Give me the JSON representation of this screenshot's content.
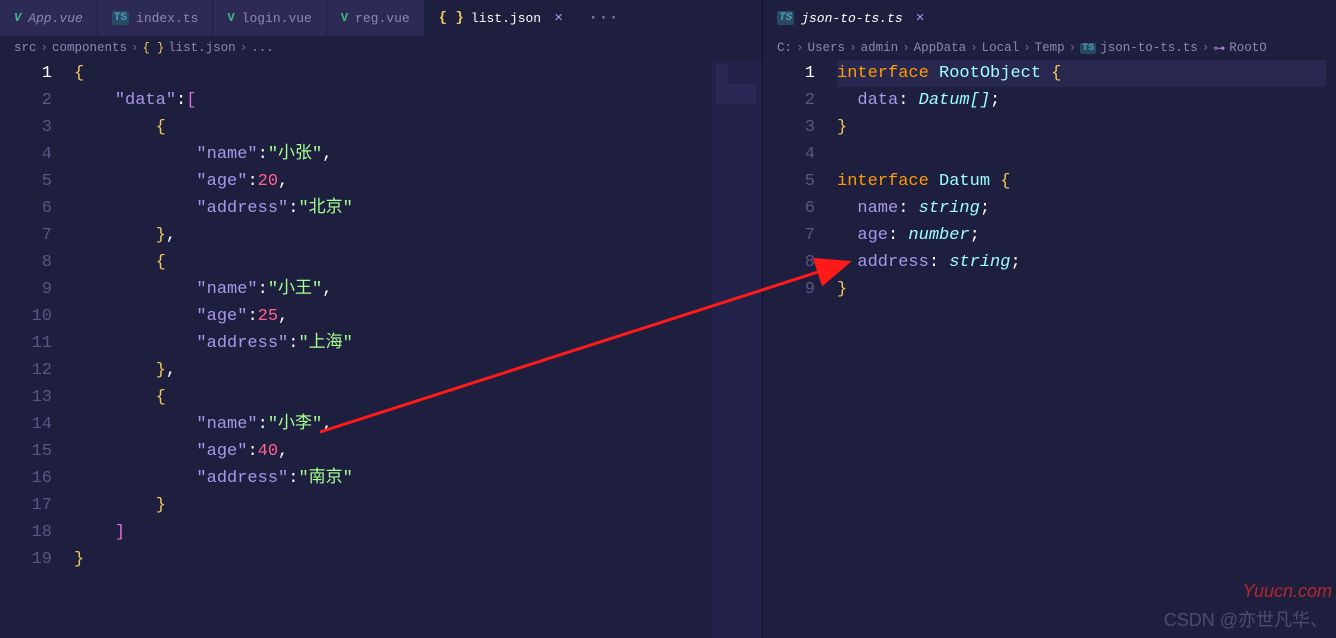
{
  "tabsLeft": [
    {
      "icon": "vue",
      "label": "App.vue",
      "active": false,
      "italic": true
    },
    {
      "icon": "ts",
      "label": "index.ts",
      "active": false
    },
    {
      "icon": "vue",
      "label": "login.vue",
      "active": false
    },
    {
      "icon": "vue",
      "label": "reg.vue",
      "active": false
    },
    {
      "icon": "json",
      "label": "list.json",
      "active": true,
      "close": true
    }
  ],
  "tabsRight": [
    {
      "icon": "ts",
      "label": "json-to-ts.ts",
      "active": true,
      "close": true,
      "italic": true
    }
  ],
  "breadcrumbsLeft": {
    "items": [
      "src",
      "components"
    ],
    "fileIcon": "json",
    "file": "list.json",
    "trail": "..."
  },
  "breadcrumbsRight": {
    "items": [
      "C:",
      "Users",
      "admin",
      "AppData",
      "Local",
      "Temp"
    ],
    "fileIcon": "ts",
    "file": "json-to-ts.ts",
    "intIcon": "interface",
    "trail": "RootO"
  },
  "leftCode": {
    "records": [
      {
        "name": "小张",
        "age": 20,
        "address": "北京"
      },
      {
        "name": "小王",
        "age": 25,
        "address": "上海"
      },
      {
        "name": "小李",
        "age": 40,
        "address": "南京"
      }
    ]
  },
  "rightCode": {
    "rootName": "RootObject",
    "rootField": "data",
    "rootType": "Datum[]",
    "datumName": "Datum",
    "fields": [
      {
        "name": "name",
        "type": "string"
      },
      {
        "name": "age",
        "type": "number"
      },
      {
        "name": "address",
        "type": "string"
      }
    ]
  },
  "watermark1": "Yuucn.com",
  "watermark2": "CSDN @亦世凡华、"
}
